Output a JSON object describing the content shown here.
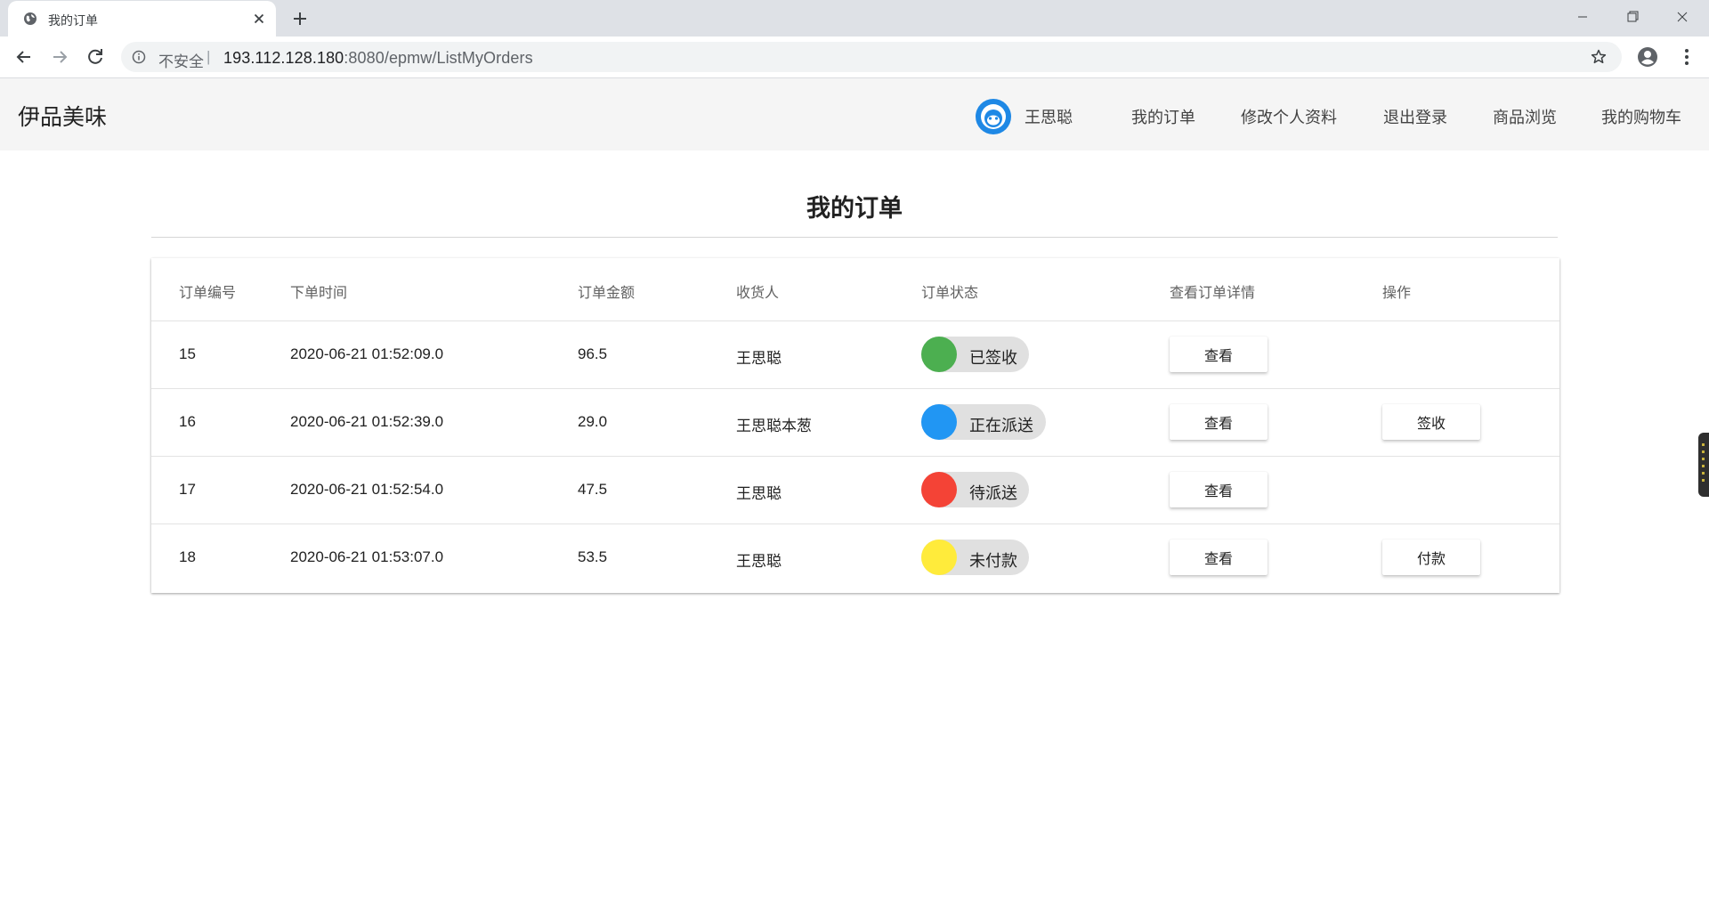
{
  "browser": {
    "tab_title": "我的订单",
    "security_label": "不安全",
    "separator": "|",
    "url_host": "193.112.128.180",
    "url_rest": ":8080/epmw/ListMyOrders"
  },
  "navbar": {
    "brand": "伊品美味",
    "user_name": "王思聪",
    "links": [
      "我的订单",
      "修改个人资料",
      "退出登录",
      "商品浏览",
      "我的购物车"
    ]
  },
  "page": {
    "title": "我的订单"
  },
  "table": {
    "headers": [
      "订单编号",
      "下单时间",
      "订单金额",
      "收货人",
      "订单状态",
      "查看订单详情",
      "操作"
    ],
    "rows": [
      {
        "id": "15",
        "time": "2020-06-21 01:52:09.0",
        "amount": "96.5",
        "receiver": "王思聪",
        "status": "已签收",
        "status_color": "#4caf50",
        "view": "查看",
        "action": ""
      },
      {
        "id": "16",
        "time": "2020-06-21 01:52:39.0",
        "amount": "29.0",
        "receiver": "王思聪本葱",
        "status": "正在派送",
        "status_color": "#2196f3",
        "view": "查看",
        "action": "签收"
      },
      {
        "id": "17",
        "time": "2020-06-21 01:52:54.0",
        "amount": "47.5",
        "receiver": "王思聪",
        "status": "待派送",
        "status_color": "#f44336",
        "view": "查看",
        "action": ""
      },
      {
        "id": "18",
        "time": "2020-06-21 01:53:07.0",
        "amount": "53.5",
        "receiver": "王思聪",
        "status": "未付款",
        "status_color": "#ffeb3b",
        "view": "查看",
        "action": "付款"
      }
    ]
  }
}
